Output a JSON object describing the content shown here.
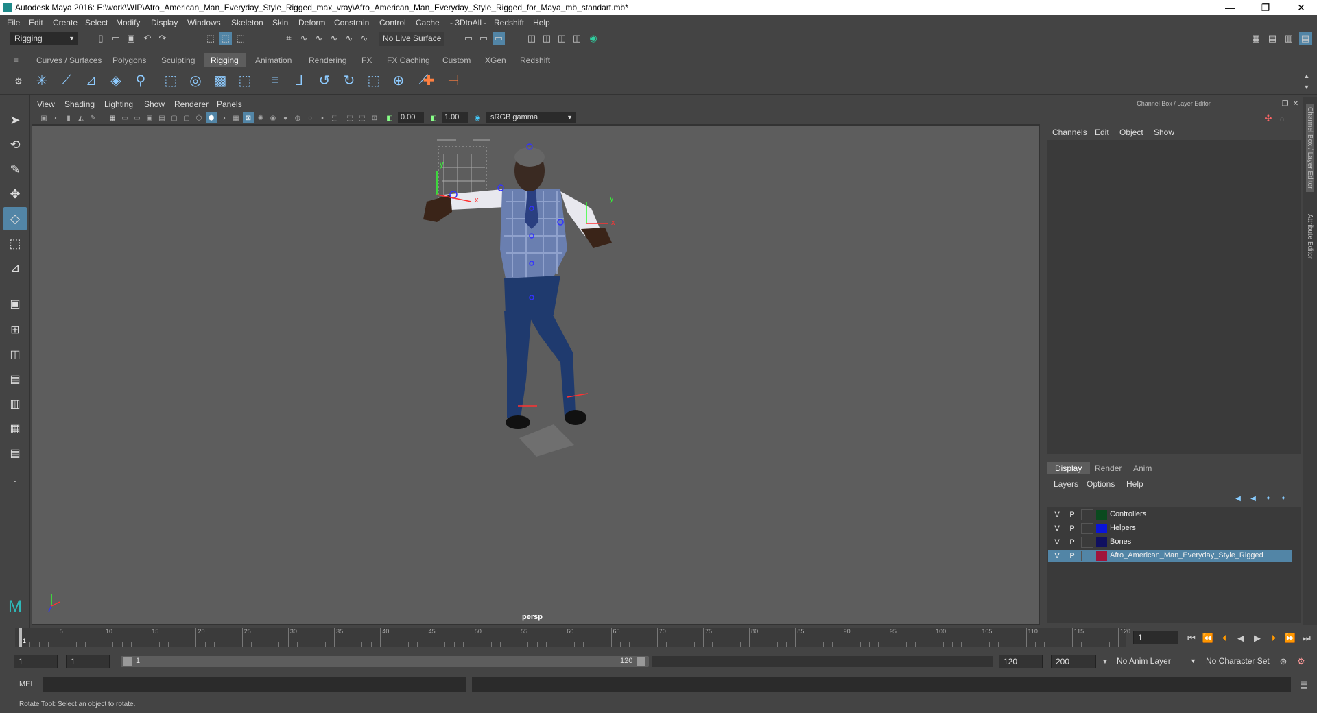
{
  "titlebar": {
    "title": "Autodesk Maya 2016: E:\\work\\WIP\\Afro_American_Man_Everyday_Style_Rigged_max_vray\\Afro_American_Man_Everyday_Style_Rigged_for_Maya_mb_standart.mb*",
    "min": "—",
    "max": "❐",
    "close": "✕"
  },
  "menubar": [
    "File",
    "Edit",
    "Create",
    "Select",
    "Modify",
    "Display",
    "Windows",
    "Skeleton",
    "Skin",
    "Deform",
    "Constrain",
    "Control",
    "Cache",
    "- 3DtoAll -",
    "Redshift",
    "Help"
  ],
  "statusline": {
    "mode": "Rigging",
    "live_surface": "No Live Surface"
  },
  "shelf_tabs": [
    "Curves / Surfaces",
    "Polygons",
    "Sculpting",
    "Rigging",
    "Animation",
    "Rendering",
    "FX",
    "FX Caching",
    "Custom",
    "XGen",
    "Redshift"
  ],
  "shelf_active": "Rigging",
  "viewport": {
    "menus": [
      "View",
      "Shading",
      "Lighting",
      "Show",
      "Renderer",
      "Panels"
    ],
    "val_a": "0.00",
    "val_b": "1.00",
    "color_space": "sRGB gamma",
    "camera": "persp",
    "axis_y": "y",
    "axis_x": "x",
    "joint_y": "y",
    "joint_x": "x"
  },
  "channel_box": {
    "title": "Channel Box / Layer Editor",
    "menus": [
      "Channels",
      "Edit",
      "Object",
      "Show"
    ]
  },
  "layer_editor": {
    "tabs": [
      "Display",
      "Render",
      "Anim"
    ],
    "menus": [
      "Layers",
      "Options",
      "Help"
    ],
    "layers": [
      {
        "v": "V",
        "p": "P",
        "name": "Controllers",
        "color": "#0a4a1e"
      },
      {
        "v": "V",
        "p": "P",
        "name": "Helpers",
        "color": "#0a14d8"
      },
      {
        "v": "V",
        "p": "P",
        "name": "Bones",
        "color": "#101060"
      },
      {
        "v": "V",
        "p": "P",
        "name": "Afro_American_Man_Everyday_Style_Rigged",
        "color": "#a0143c"
      }
    ]
  },
  "side_tabs": {
    "tab1": "Channel Box / Layer Editor",
    "tab2": "Attribute Editor"
  },
  "timeline": {
    "ticks": [
      "1",
      "5",
      "10",
      "15",
      "20",
      "25",
      "30",
      "35",
      "40",
      "45",
      "50",
      "55",
      "60",
      "65",
      "70",
      "75",
      "80",
      "85",
      "90",
      "95",
      "100",
      "105",
      "110",
      "115",
      "120"
    ],
    "current_frame": "1"
  },
  "range": {
    "start": "1",
    "playback_start": "1",
    "slider_start": "1",
    "slider_end": "120",
    "playback_end": "120",
    "end": "200",
    "anim_layer": "No Anim Layer",
    "character_set": "No Character Set"
  },
  "cmdline": {
    "label": "MEL"
  },
  "helpline": {
    "text": "Rotate Tool: Select an object to rotate."
  },
  "accent": "#5285a6"
}
